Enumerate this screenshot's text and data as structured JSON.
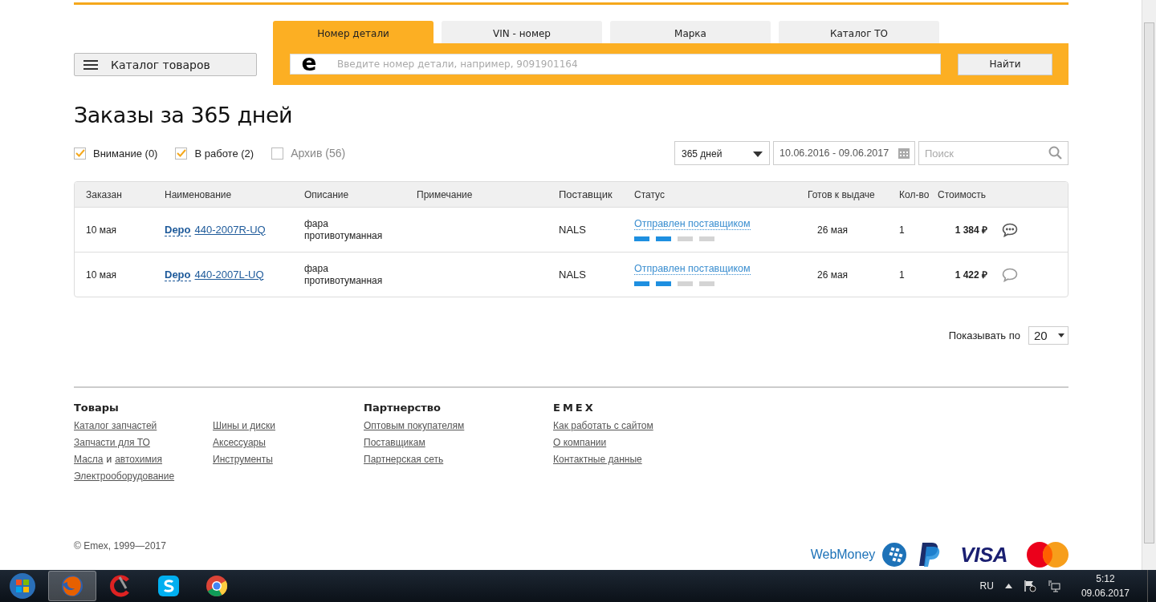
{
  "header": {
    "catalog_button": "Каталог товаров",
    "tabs": [
      {
        "label": "Номер детали",
        "selected": true
      },
      {
        "label": "VIN - номер",
        "selected": false
      },
      {
        "label": "Марка",
        "selected": false
      },
      {
        "label": "Каталог ТО",
        "selected": false
      }
    ],
    "search": {
      "logo": "e",
      "placeholder": "Введите номер детали, например, 9091901164",
      "button": "Найти"
    }
  },
  "title": "Заказы за 365 дней",
  "filters": [
    {
      "label": "Внимание (0)",
      "checked": true
    },
    {
      "label": "В работе (2)",
      "checked": true
    },
    {
      "label": "Архив (56)",
      "checked": false
    }
  ],
  "period": {
    "value": "365 дней",
    "range": "10.06.2016 - 09.06.2017",
    "search_placeholder": "Поиск"
  },
  "table": {
    "columns": [
      "Заказан",
      "Наименование",
      "Описание",
      "Примечание",
      "Поставщик",
      "Статус",
      "Готов к выдаче",
      "Кол-во",
      "Стоимость"
    ],
    "rows": [
      {
        "ordered": "10 мая",
        "brand": "Depo",
        "part": "440-2007R-UQ",
        "description": "фара противотуманная",
        "supplier": "NALS",
        "status": "Отправлен поставщиком",
        "level": 0.5,
        "ready": "26 мая",
        "qty": "1",
        "price": "1 384 ₽",
        "has_comments": true
      },
      {
        "ordered": "10 мая",
        "brand": "Depo",
        "part": "440-2007L-UQ",
        "description": "фара противотуманная",
        "supplier": "NALS",
        "status": "Отправлен поставщиком",
        "level": 0.5,
        "ready": "26 мая",
        "qty": "1",
        "price": "1 422 ₽",
        "has_comments": false
      }
    ]
  },
  "paging": {
    "label": "Показывать по",
    "value": "20"
  },
  "footer": {
    "sections": [
      {
        "title": "Товары",
        "columns": [
          [
            [
              {
                "text": "Каталог запчастей",
                "kind": "link"
              }
            ],
            [
              {
                "text": "Запчасти для ТО",
                "kind": "link"
              }
            ],
            [
              {
                "text": "Масла",
                "kind": "link"
              },
              {
                "text": "и",
                "kind": "plain"
              },
              {
                "text": "автохимия",
                "kind": "link"
              }
            ],
            [
              {
                "text": "Электрооборудование",
                "kind": "link"
              }
            ]
          ],
          [
            [
              {
                "text": "Шины и диски",
                "kind": "link"
              }
            ],
            [
              {
                "text": "Аксессуары",
                "kind": "link"
              }
            ],
            [
              {
                "text": "Инструменты",
                "kind": "link"
              }
            ]
          ]
        ]
      },
      {
        "title": "Партнерство",
        "columns": [
          [
            [
              {
                "text": "Оптовым покупателям",
                "kind": "link"
              }
            ],
            [
              {
                "text": "Поставщикам",
                "kind": "link"
              }
            ],
            [
              {
                "text": "Партнерская сеть",
                "kind": "link"
              }
            ]
          ]
        ]
      },
      {
        "title": "EMEX",
        "columns": [
          [
            [
              {
                "text": "Как работать с сайтом",
                "kind": "link"
              }
            ],
            [
              {
                "text": "О компании",
                "kind": "link"
              }
            ],
            [
              {
                "text": "Контактные данные",
                "kind": "link"
              }
            ]
          ]
        ]
      }
    ],
    "copyright": "© Emex, 1999—2017",
    "webmoney": "WebMoney",
    "visa": "VISA"
  },
  "taskbar": {
    "apps": [
      {
        "kind": "firefox",
        "selected": true
      },
      {
        "kind": "ccleaner",
        "selected": false
      },
      {
        "kind": "skype",
        "selected": false
      },
      {
        "kind": "chrome",
        "selected": false
      }
    ],
    "language": "RU",
    "time": "5:12",
    "date": "09.06.2017"
  }
}
